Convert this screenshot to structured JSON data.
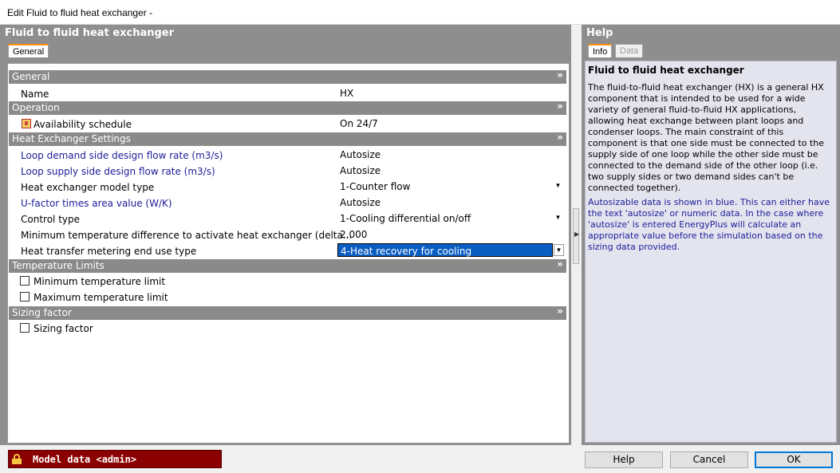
{
  "window": {
    "title": "Edit Fluid to fluid heat exchanger -"
  },
  "left": {
    "section_title": "Fluid to fluid heat exchanger",
    "tabs": [
      {
        "label": "General",
        "active": true
      }
    ]
  },
  "groups": {
    "general": {
      "title": "General",
      "rows": [
        {
          "label": "Name",
          "value": "HX"
        }
      ]
    },
    "operation": {
      "title": "Operation",
      "rows": [
        {
          "label": "Availability schedule",
          "value": "On 24/7",
          "icon": "schedule-icon"
        }
      ]
    },
    "settings": {
      "title": "Heat Exchanger Settings",
      "rows": [
        {
          "label": "Loop demand side design flow rate (m3/s)",
          "value": "Autosize",
          "autosizable": true
        },
        {
          "label": "Loop supply side design flow rate (m3/s)",
          "value": "Autosize",
          "autosizable": true
        },
        {
          "label": "Heat exchanger model type",
          "value": "1-Counter flow",
          "dropdown": true
        },
        {
          "label": "U-factor times area value (W/K)",
          "value": "Autosize",
          "autosizable": true
        },
        {
          "label": "Control type",
          "value": "1-Cooling differential on/off",
          "dropdown": true
        },
        {
          "label": "Minimum temperature difference to activate heat exchanger (delta...",
          "value": "2.000"
        },
        {
          "label": "Heat transfer metering end use type",
          "value": "4-Heat recovery for cooling",
          "dropdown": true,
          "selected": true
        }
      ]
    },
    "temp_limits": {
      "title": "Temperature Limits",
      "rows": [
        {
          "label": "Minimum temperature limit",
          "checked": false
        },
        {
          "label": "Maximum temperature limit",
          "checked": false
        }
      ]
    },
    "sizing": {
      "title": "Sizing factor",
      "rows": [
        {
          "label": "Sizing factor",
          "checked": false
        }
      ]
    }
  },
  "help": {
    "section_title": "Help",
    "tabs": [
      {
        "label": "Info",
        "active": true
      },
      {
        "label": "Data",
        "active": false
      }
    ],
    "title": "Fluid to fluid heat exchanger",
    "paragraph1": "The fluid-to-fluid heat exchanger (HX) is a general HX component that is intended to be used for a wide variety of general fluid-to-fluid HX applications, allowing heat exchange between plant loops and condenser loops. The main constraint of this component is that one side must be connected to the supply side of one loop while the other side must be connected to the demand side of the other loop (i.e. two supply sides or two demand sides can't be connected together).",
    "paragraph2": "Autosizable data is shown in blue. This can either have the text 'autosize' or numeric data. In the case where 'autosize' is entered EnergyPlus will calculate an appropriate value before the simulation based on the sizing data provided."
  },
  "footer": {
    "model_data": "Model data <admin>",
    "help_button": "Help",
    "cancel_button": "Cancel",
    "ok_button": "OK"
  },
  "colors": {
    "autosize_label": "#1c1c99",
    "selection": "#0a5dc2",
    "model_data_bg": "#8b0000",
    "tab_accent": "#ff8c00"
  }
}
